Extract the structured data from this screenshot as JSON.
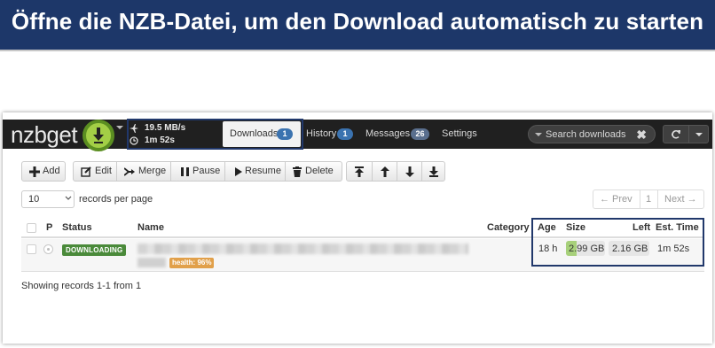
{
  "banner": {
    "title": "Öffne die NZB-Datei, um den Download automatisch zu starten"
  },
  "navbar": {
    "logo": "nzbget",
    "speed": "19.5 MB/s",
    "time_left": "1m 52s",
    "tabs": [
      {
        "label": "Downloads",
        "badge": "1",
        "active": true
      },
      {
        "label": "History",
        "badge": "1"
      },
      {
        "label": "Messages",
        "badge": "26"
      },
      {
        "label": "Settings"
      }
    ],
    "search": {
      "placeholder": "Search downloads"
    }
  },
  "toolbar": {
    "add": "Add",
    "edit": "Edit",
    "merge": "Merge",
    "pause": "Pause",
    "resume": "Resume",
    "delete": "Delete",
    "move_icons": [
      "move-top-icon",
      "move-up-icon",
      "move-down-icon",
      "move-bottom-icon"
    ]
  },
  "records": {
    "per_page_value": "10",
    "per_page_label": "records per page"
  },
  "pager": {
    "prev": "← Prev",
    "page": "1",
    "next": "Next →"
  },
  "table": {
    "headers": {
      "priority": "P",
      "status": "Status",
      "name": "Name",
      "category": "Category",
      "age": "Age",
      "size": "Size",
      "left": "Left",
      "est_time": "Est. Time"
    },
    "rows": [
      {
        "status": "DOWNLOADING",
        "health": "health: 96%",
        "category": "",
        "age": "18 h",
        "size": "2.99 GB",
        "left": "2.16 GB",
        "est_time": "1m 52s",
        "progress_fraction": 0.28
      }
    ]
  },
  "footer": {
    "text": "Showing records 1-1 from 1"
  },
  "colors": {
    "banner": "#1d3769",
    "navbar": "#202020",
    "highlight_box": "#21386b",
    "status_badge": "#4a8a3a",
    "health_badge": "#e1a04a",
    "progress": "#a7d07a",
    "tab_badge": "#3b73b0"
  }
}
